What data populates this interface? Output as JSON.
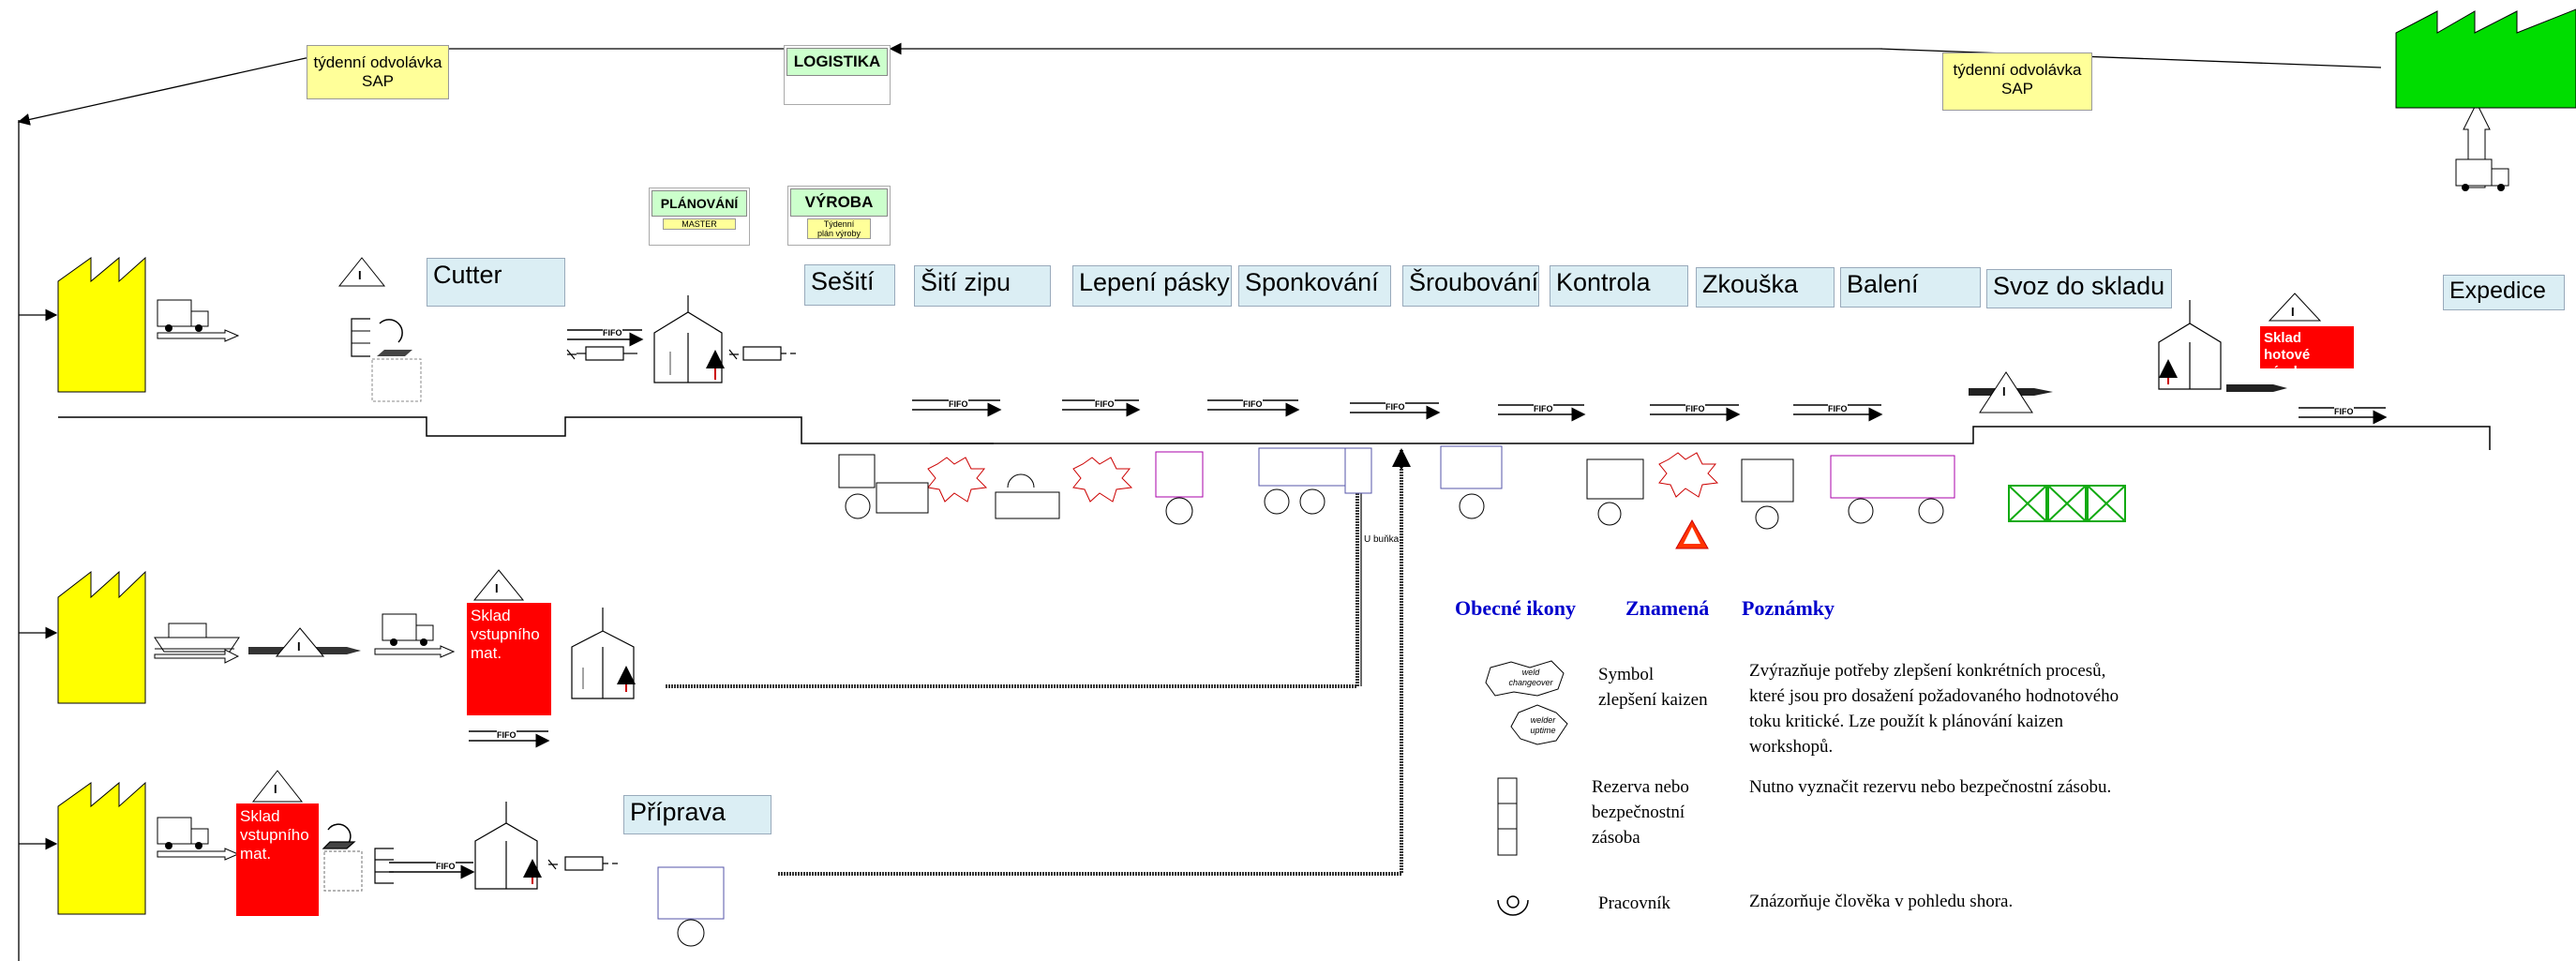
{
  "notes": {
    "weekly_left": [
      "týdenní odvolávka",
      "SAP"
    ],
    "weekly_right": [
      "týdenní odvolávka",
      "SAP"
    ]
  },
  "headers": {
    "logistika": "LOGISTIKA",
    "planovani": "PLÁNOVÁNÍ",
    "master": "MASTER",
    "vyroba": "VÝROBA",
    "vyroba_sub": [
      "Týdenní",
      "plán výroby"
    ]
  },
  "processes": {
    "cutter": "Cutter",
    "priprava": "Příprava",
    "expedice": "Expedice",
    "line": [
      "Sešití",
      "Šití zipu",
      "Lepení pásky",
      "Sponkování",
      "Šroubování",
      "Kontrola",
      "Zkouška",
      "Balení",
      "Svoz do skladu"
    ]
  },
  "stocks": {
    "sklad_vstupniho_1": [
      "Sklad",
      "vstupního",
      "mat."
    ],
    "sklad_vstupniho_2": [
      "Sklad",
      "vstupního",
      "mat."
    ],
    "sklad_hotove": [
      "Sklad hotové",
      "výroby"
    ]
  },
  "symbols": {
    "fifo": "FIFO",
    "inventory": "I",
    "u_bunka": "U buňka"
  },
  "legend": {
    "headers": [
      "Obecné ikony",
      "Znamená",
      "Poznámky"
    ],
    "rows": [
      {
        "icon": "kaizen-burst-icon",
        "icon_text": [
          "weld",
          "changeover",
          "welder",
          "uptime"
        ],
        "meaning": [
          "Symbol",
          "zlepšení kaizen"
        ],
        "note": [
          "Zvýrazňuje potřeby zlepšení konkrétních procesů,",
          "které jsou pro dosažení požadovaného hodnotového",
          "toku kritické. Lze použít k plánování kaizen",
          "workshopů."
        ]
      },
      {
        "icon": "buffer-stock-icon",
        "meaning": [
          "Rezerva nebo",
          "bezpečnostní",
          "zásoba"
        ],
        "note": [
          "Nutno vyznačit rezervu nebo bezpečnostní zásobu."
        ]
      },
      {
        "icon": "operator-icon",
        "meaning": [
          "Pracovník"
        ],
        "note": [
          "Znázorňuje člověka v pohledu shora."
        ]
      }
    ]
  },
  "colors": {
    "supplier": "#ffff00",
    "customer": "#00cc00",
    "stock": "#ff0000",
    "process_fill": "#dbeef4",
    "note_fill": "#ffff99",
    "legend_heading": "#0000cc"
  }
}
